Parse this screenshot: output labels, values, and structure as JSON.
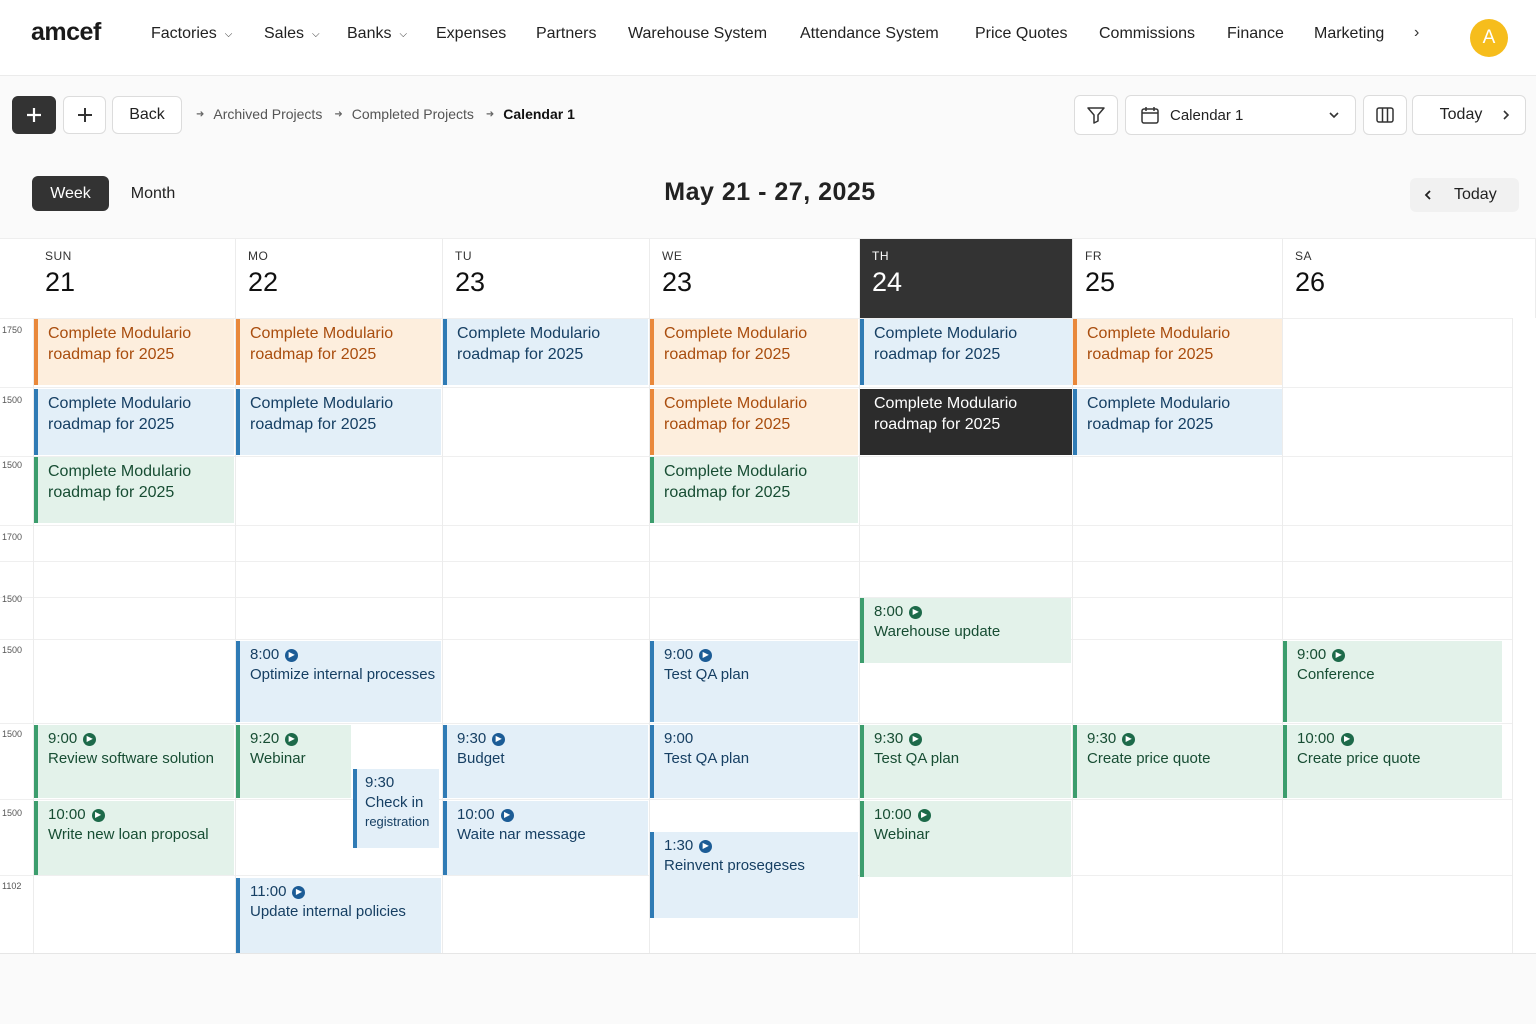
{
  "app": {
    "logo": "amcef"
  },
  "nav": {
    "items": [
      {
        "label": "Factories",
        "chevron": true
      },
      {
        "label": "Sales",
        "chevron": true
      },
      {
        "label": "Banks",
        "chevron": true
      },
      {
        "label": "Expenses"
      },
      {
        "label": "Partners"
      },
      {
        "label": "Warehouse System"
      },
      {
        "label": "Attendance System"
      },
      {
        "label": "Price Quotes"
      },
      {
        "label": "Commissions"
      },
      {
        "label": "Finance"
      },
      {
        "label": "Marketing"
      }
    ],
    "more": "›",
    "avatar": "A"
  },
  "toolbar": {
    "back_label": "Back",
    "breadcrumb": [
      "Archived Projects",
      "Completed Projects",
      "Calendar 1"
    ],
    "calendar_select": "Calendar 1",
    "today_label": "Today"
  },
  "view": {
    "week_label": "Week",
    "month_label": "Month",
    "range_title": "May  21  -  27, 2025",
    "today_label": "Today"
  },
  "days": [
    {
      "name": "SUN",
      "num": "21"
    },
    {
      "name": "MO",
      "num": "22"
    },
    {
      "name": "TU",
      "num": "23"
    },
    {
      "name": "WE",
      "num": "23"
    },
    {
      "name": "TH",
      "num": "24",
      "today": true
    },
    {
      "name": "FR",
      "num": "25"
    },
    {
      "name": "SA",
      "num": "26"
    }
  ],
  "time_labels": [
    "1750",
    "1500",
    "1500",
    "1700",
    "1500",
    "1500",
    "1500",
    "1500",
    "1102"
  ],
  "events": {
    "roadmap": "Complete Modulario roadmap for 2025",
    "e1": {
      "time": "8:00",
      "title": "Optimize internal processes"
    },
    "e2": {
      "time": "9:00",
      "title": "Test QA plan"
    },
    "e3": {
      "time": "8:00",
      "title": "Warehouse update"
    },
    "e4": {
      "time": "9:00",
      "title": "Conference"
    },
    "e5": {
      "time": "9:00",
      "title": "Review software solution"
    },
    "e6": {
      "time": "9:20",
      "title": "Webinar"
    },
    "e7": {
      "time": "9:30",
      "title": "Check in",
      "sub": "registration"
    },
    "e8": {
      "time": "9:30",
      "title": "Budget"
    },
    "e9": {
      "time": "9:00",
      "title": "Test QA plan"
    },
    "e10": {
      "time": "9:30",
      "title": "Test QA plan"
    },
    "e11": {
      "time": "9:30",
      "title": "Create price quote"
    },
    "e12": {
      "time": "10:00",
      "title": "Create price quote"
    },
    "e13": {
      "time": "10:00",
      "title": "Write new loan proposal"
    },
    "e14": {
      "time": "10:00",
      "title": "Waite nar message"
    },
    "e15": {
      "time": "1:30",
      "title": "Reinvent prosegeses"
    },
    "e16": {
      "time": "10:00",
      "title": "Webinar"
    },
    "e17": {
      "time": "11:00",
      "title": "Update internal policies"
    }
  },
  "colors": {
    "orange": "#e9883b",
    "blue": "#2f7bb5",
    "green": "#3c9d6d",
    "dark": "#2c2c2c",
    "avatar": "#f6bd1c"
  }
}
